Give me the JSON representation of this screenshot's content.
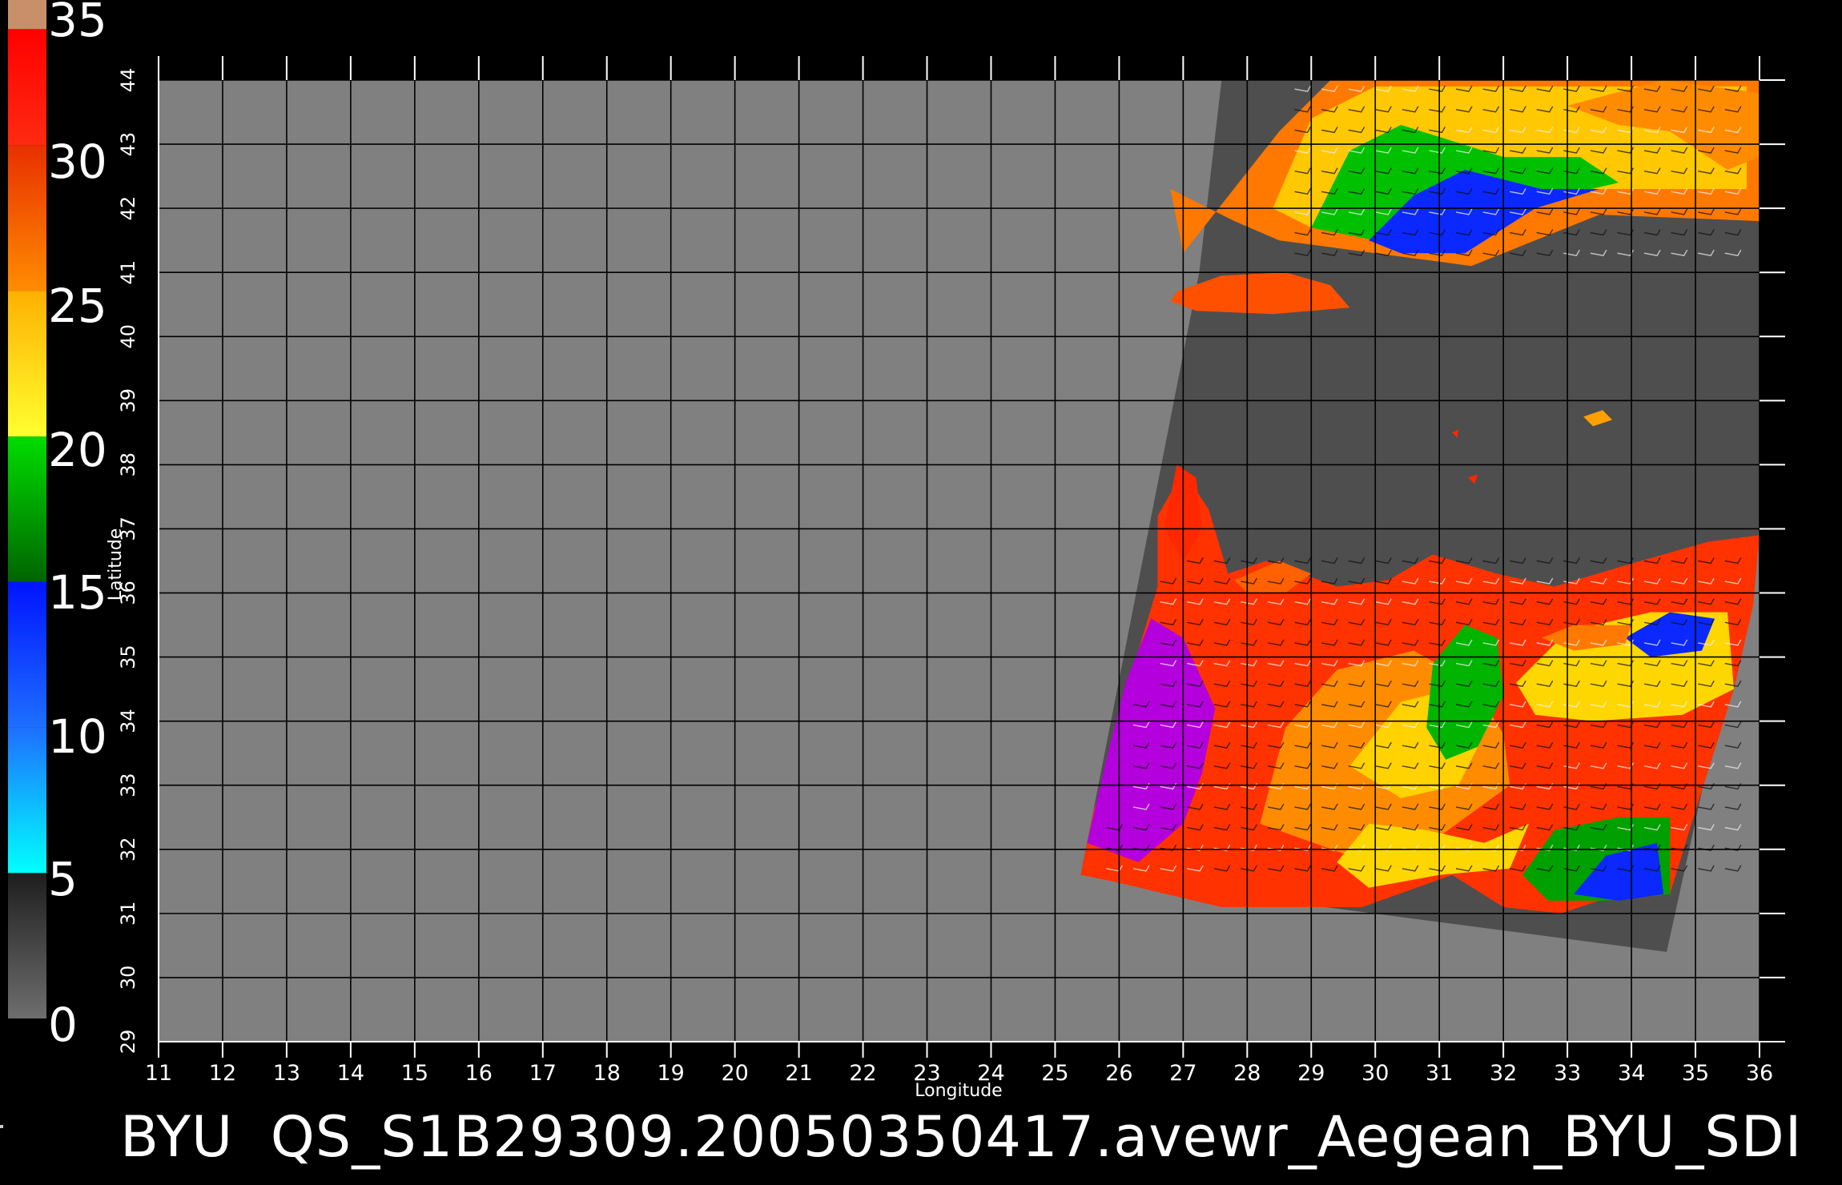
{
  "colorbar": {
    "tick_labels": [
      "35",
      "30",
      "25",
      "20",
      "15",
      "10",
      "5",
      "0"
    ],
    "segments": [
      {
        "from": 0,
        "to": 5,
        "colors": [
          "#6e6e6e",
          "#1e1e1e"
        ]
      },
      {
        "from": 5,
        "to": 10,
        "colors": [
          "#00ffff",
          "#1e6fff"
        ]
      },
      {
        "from": 10,
        "to": 15,
        "colors": [
          "#1e6fff",
          "#0014ff"
        ]
      },
      {
        "from": 15,
        "to": 20,
        "colors": [
          "#006400",
          "#00dd00"
        ]
      },
      {
        "from": 20,
        "to": 25,
        "colors": [
          "#ffff30",
          "#ffb000"
        ]
      },
      {
        "from": 25,
        "to": 30,
        "colors": [
          "#ff8c00",
          "#e83000"
        ]
      },
      {
        "from": 30,
        "to": 34,
        "colors": [
          "#ff2a10",
          "#ff0000"
        ]
      },
      {
        "from": 34,
        "to": 35,
        "colors": [
          "#c8906a",
          "#c8906a"
        ]
      }
    ]
  },
  "axes": {
    "xlabel": "Longitude",
    "ylabel": "Latitude",
    "xlim": [
      11,
      36
    ],
    "ylim": [
      29,
      44
    ],
    "x_ticks": [
      "11",
      "12",
      "13",
      "14",
      "15",
      "16",
      "17",
      "18",
      "19",
      "20",
      "21",
      "22",
      "23",
      "24",
      "25",
      "26",
      "27",
      "28",
      "29",
      "30",
      "31",
      "32",
      "33",
      "34",
      "35",
      "36"
    ],
    "y_ticks": [
      "29",
      "30",
      "31",
      "32",
      "33",
      "34",
      "35",
      "36",
      "37",
      "38",
      "39",
      "40",
      "41",
      "42",
      "43",
      "44"
    ],
    "grid": true
  },
  "swath": {
    "corners_lonlat": [
      [
        27.6,
        44.0
      ],
      [
        36.0,
        44.0
      ],
      [
        36.0,
        37.0
      ],
      [
        34.55,
        30.4
      ],
      [
        25.4,
        31.6
      ],
      [
        27.25,
        41.0
      ]
    ]
  },
  "regions": [
    {
      "name": "black-sea-band",
      "points": [
        [
          27.0,
          41.3
        ],
        [
          28.5,
          43.2
        ],
        [
          29.3,
          44.0
        ],
        [
          36.0,
          44.0
        ],
        [
          36.0,
          41.8
        ],
        [
          33.5,
          41.9
        ],
        [
          31.5,
          41.1
        ],
        [
          30.0,
          41.3
        ],
        [
          28.5,
          41.5
        ],
        [
          27.8,
          41.8
        ],
        [
          26.8,
          42.3
        ]
      ],
      "color": "#ff7800"
    },
    {
      "name": "black-sea-yellow",
      "points": [
        [
          28.4,
          42.0
        ],
        [
          29.0,
          43.4
        ],
        [
          30.0,
          43.9
        ],
        [
          35.8,
          43.9
        ],
        [
          35.8,
          42.3
        ],
        [
          33.0,
          42.3
        ],
        [
          31.0,
          41.6
        ],
        [
          29.8,
          41.7
        ],
        [
          29.0,
          41.7
        ]
      ],
      "color": "#ffc800"
    },
    {
      "name": "black-sea-green",
      "points": [
        [
          29.0,
          41.7
        ],
        [
          29.6,
          42.9
        ],
        [
          30.4,
          43.3
        ],
        [
          32.0,
          42.8
        ],
        [
          33.2,
          42.8
        ],
        [
          33.8,
          42.4
        ],
        [
          32.5,
          42.1
        ],
        [
          31.2,
          41.3
        ],
        [
          30.0,
          41.5
        ]
      ],
      "color": "#00c000"
    },
    {
      "name": "black-sea-blue",
      "points": [
        [
          29.9,
          41.5
        ],
        [
          30.6,
          42.2
        ],
        [
          31.4,
          42.6
        ],
        [
          32.6,
          42.3
        ],
        [
          33.5,
          42.3
        ],
        [
          32.5,
          42.0
        ],
        [
          31.4,
          41.3
        ],
        [
          30.4,
          41.3
        ]
      ],
      "color": "#0a28ff"
    },
    {
      "name": "black-sea-orange-east",
      "points": [
        [
          33.0,
          43.6
        ],
        [
          34.5,
          44.0
        ],
        [
          36.0,
          43.8
        ],
        [
          36.0,
          42.8
        ],
        [
          35.5,
          42.6
        ],
        [
          34.6,
          43.2
        ],
        [
          33.8,
          43.3
        ]
      ],
      "color": "#ff8c00"
    },
    {
      "name": "marmara",
      "points": [
        [
          26.9,
          40.7
        ],
        [
          27.6,
          40.95
        ],
        [
          28.6,
          41.0
        ],
        [
          29.3,
          40.8
        ],
        [
          29.6,
          40.45
        ],
        [
          28.4,
          40.35
        ],
        [
          27.2,
          40.4
        ],
        [
          26.8,
          40.55
        ]
      ],
      "color": "#ff5000"
    },
    {
      "name": "mediterranean-red",
      "points": [
        [
          25.4,
          31.6
        ],
        [
          25.6,
          32.6
        ],
        [
          26.0,
          33.8
        ],
        [
          26.3,
          35.1
        ],
        [
          26.6,
          36.1
        ],
        [
          26.6,
          37.2
        ],
        [
          27.0,
          37.9
        ],
        [
          27.4,
          37.3
        ],
        [
          27.7,
          36.3
        ],
        [
          28.3,
          36.5
        ],
        [
          29.4,
          36.1
        ],
        [
          30.2,
          36.2
        ],
        [
          30.9,
          36.6
        ],
        [
          31.9,
          36.3
        ],
        [
          32.8,
          36.1
        ],
        [
          33.8,
          36.4
        ],
        [
          35.2,
          36.8
        ],
        [
          36.0,
          36.9
        ],
        [
          35.9,
          35.8
        ],
        [
          35.6,
          34.5
        ],
        [
          35.0,
          32.6
        ],
        [
          34.6,
          31.3
        ],
        [
          33.8,
          31.3
        ],
        [
          32.9,
          31.0
        ],
        [
          32.0,
          31.1
        ],
        [
          31.2,
          31.6
        ],
        [
          29.8,
          31.1
        ],
        [
          27.6,
          31.1
        ],
        [
          25.9,
          31.5
        ]
      ],
      "color": "#ff3200"
    },
    {
      "name": "med-purple-west",
      "points": [
        [
          25.5,
          32.1
        ],
        [
          25.8,
          33.4
        ],
        [
          26.1,
          34.6
        ],
        [
          26.5,
          35.6
        ],
        [
          27.0,
          35.3
        ],
        [
          27.5,
          34.2
        ],
        [
          27.3,
          33.2
        ],
        [
          27.0,
          32.4
        ],
        [
          26.3,
          31.8
        ]
      ],
      "color": "#b400dc"
    },
    {
      "name": "med-orange-center",
      "points": [
        [
          28.2,
          32.4
        ],
        [
          28.6,
          33.9
        ],
        [
          29.4,
          34.8
        ],
        [
          30.6,
          35.1
        ],
        [
          31.5,
          34.6
        ],
        [
          32.0,
          33.8
        ],
        [
          32.1,
          33.0
        ],
        [
          31.0,
          32.2
        ],
        [
          29.6,
          31.9
        ]
      ],
      "color": "#ff8c00"
    },
    {
      "name": "med-yellow-center",
      "points": [
        [
          29.6,
          33.3
        ],
        [
          30.4,
          34.3
        ],
        [
          31.2,
          34.5
        ],
        [
          31.7,
          33.8
        ],
        [
          31.3,
          33.0
        ],
        [
          30.4,
          32.8
        ]
      ],
      "color": "#ffd200"
    },
    {
      "name": "med-green-center",
      "points": [
        [
          30.8,
          33.9
        ],
        [
          30.9,
          34.9
        ],
        [
          31.4,
          35.5
        ],
        [
          31.9,
          35.3
        ],
        [
          32.0,
          34.4
        ],
        [
          31.6,
          33.6
        ],
        [
          31.1,
          33.4
        ]
      ],
      "color": "#00b400"
    },
    {
      "name": "med-yellow-east",
      "points": [
        [
          32.2,
          34.6
        ],
        [
          33.0,
          35.4
        ],
        [
          34.3,
          35.7
        ],
        [
          35.5,
          35.7
        ],
        [
          35.6,
          34.5
        ],
        [
          34.8,
          34.1
        ],
        [
          33.4,
          34.0
        ],
        [
          32.5,
          34.1
        ]
      ],
      "color": "#ffd700"
    },
    {
      "name": "med-blue-east",
      "points": [
        [
          33.9,
          35.3
        ],
        [
          34.6,
          35.7
        ],
        [
          35.3,
          35.6
        ],
        [
          35.1,
          35.1
        ],
        [
          34.3,
          35.0
        ]
      ],
      "color": "#0a28ff"
    },
    {
      "name": "med-green-south",
      "points": [
        [
          32.3,
          31.6
        ],
        [
          32.8,
          32.3
        ],
        [
          33.8,
          32.5
        ],
        [
          34.6,
          32.5
        ],
        [
          34.6,
          31.3
        ],
        [
          33.6,
          31.2
        ],
        [
          32.7,
          31.2
        ]
      ],
      "color": "#00a000"
    },
    {
      "name": "med-blue-south",
      "points": [
        [
          33.1,
          31.3
        ],
        [
          33.6,
          31.9
        ],
        [
          34.4,
          32.1
        ],
        [
          34.5,
          31.3
        ],
        [
          33.8,
          31.2
        ]
      ],
      "color": "#0a28ff"
    },
    {
      "name": "med-yellow-south",
      "points": [
        [
          29.4,
          31.8
        ],
        [
          29.9,
          32.4
        ],
        [
          30.8,
          32.3
        ],
        [
          31.7,
          32.1
        ],
        [
          32.4,
          32.4
        ],
        [
          32.1,
          31.7
        ],
        [
          31.0,
          31.6
        ],
        [
          29.9,
          31.4
        ]
      ],
      "color": "#ffd700"
    },
    {
      "name": "aegean-strip",
      "points": [
        [
          26.7,
          37.0
        ],
        [
          26.9,
          38.0
        ],
        [
          27.2,
          37.8
        ],
        [
          27.3,
          37.0
        ],
        [
          27.0,
          36.5
        ]
      ],
      "color": "#ff2800"
    },
    {
      "name": "crete-outline",
      "points": [
        [
          27.8,
          36.2
        ],
        [
          28.5,
          36.5
        ],
        [
          29.0,
          36.3
        ],
        [
          28.6,
          36.0
        ],
        [
          28.0,
          36.0
        ]
      ],
      "color": "#ff6000"
    },
    {
      "name": "cyprus-edge",
      "points": [
        [
          32.6,
          35.3
        ],
        [
          33.1,
          35.5
        ],
        [
          34.0,
          35.5
        ],
        [
          33.9,
          35.2
        ],
        [
          33.1,
          35.1
        ]
      ],
      "color": "#ff7800"
    },
    {
      "name": "lake-islet",
      "points": [
        [
          33.25,
          38.75
        ],
        [
          33.55,
          38.85
        ],
        [
          33.7,
          38.7
        ],
        [
          33.4,
          38.6
        ]
      ],
      "color": "#ffa000"
    },
    {
      "name": "dot-1",
      "points": [
        [
          31.45,
          37.8
        ],
        [
          31.6,
          37.85
        ],
        [
          31.55,
          37.7
        ]
      ],
      "color": "#ff2800"
    },
    {
      "name": "dot-2",
      "points": [
        [
          31.2,
          38.5
        ],
        [
          31.3,
          38.55
        ],
        [
          31.28,
          38.42
        ]
      ],
      "color": "#ff2800"
    }
  ],
  "filename": "BYU  QS_S1B29309.20050350417.avewr_Aegean_BYU_SDI"
}
